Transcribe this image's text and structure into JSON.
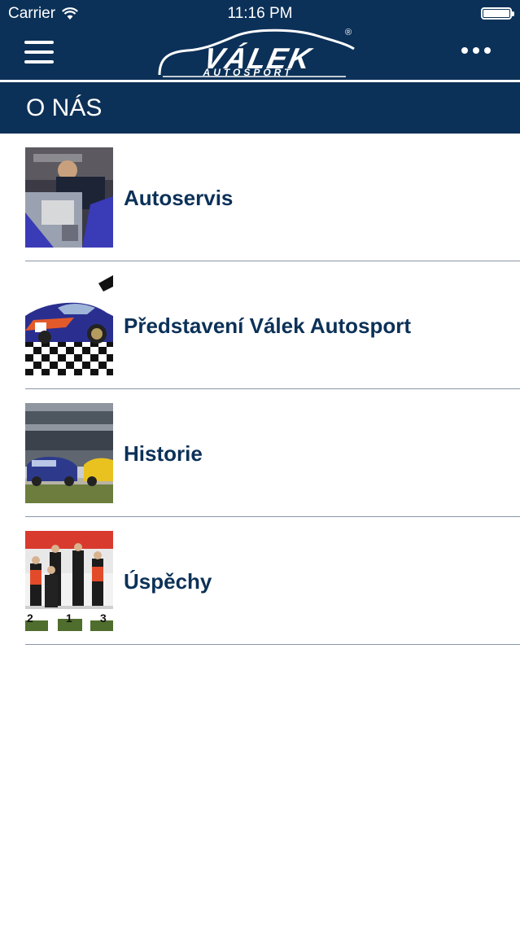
{
  "status_bar": {
    "carrier": "Carrier",
    "time": "11:16 PM"
  },
  "header": {
    "logo_title": "VÁLEK",
    "logo_subtitle": "AUTOSPORT",
    "logo_registered": "®",
    "menu_icon": "hamburger-menu-icon",
    "more_icon": "more-dots-icon"
  },
  "section": {
    "title": "O NÁS"
  },
  "items": [
    {
      "label": "Autoservis",
      "thumbnail": "mechanic-engine-photo"
    },
    {
      "label": "Představení Válek Autosport",
      "thumbnail": "race-car-checkered-flag-photo"
    },
    {
      "label": "Historie",
      "thumbnail": "race-track-cars-photo"
    },
    {
      "label": "Úspěchy",
      "thumbnail": "podium-winners-photo"
    }
  ],
  "colors": {
    "primary": "#0c3158",
    "text_primary": "#0c3158",
    "separator": "#8a97a6",
    "background": "#ffffff"
  }
}
